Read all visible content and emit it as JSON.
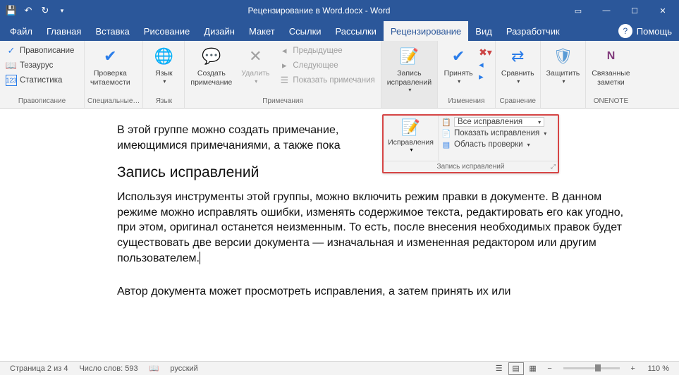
{
  "titlebar": {
    "title": "Рецензирование в Word.docx - Word"
  },
  "menu": {
    "file": "Файл",
    "home": "Главная",
    "insert": "Вставка",
    "draw": "Рисование",
    "design": "Дизайн",
    "layout": "Макет",
    "references": "Ссылки",
    "mailings": "Рассылки",
    "review": "Рецензирование",
    "view": "Вид",
    "developer": "Разработчик",
    "help": "Помощь"
  },
  "ribbon": {
    "proofing": {
      "spelling": "Правописание",
      "thesaurus": "Тезаурус",
      "statistics": "Статистика",
      "label": "Правописание"
    },
    "accessibility": {
      "check": "Проверка\nчитаемости",
      "label": "Специальные…"
    },
    "language": {
      "btn": "Язык",
      "label": "Язык"
    },
    "comments": {
      "new": "Создать\nпримечание",
      "delete": "Удалить",
      "prev": "Предыдущее",
      "next": "Следующее",
      "show": "Показать примечания",
      "label": "Примечания"
    },
    "tracking": {
      "track": "Запись\nисправлений",
      "label": ""
    },
    "changes": {
      "accept": "Принять",
      "label": "Изменения"
    },
    "compare": {
      "btn": "Сравнить",
      "label": "Сравнение"
    },
    "protect": {
      "btn": "Защитить",
      "label": ""
    },
    "onenote": {
      "btn": "Связанные\nзаметки",
      "label": "ONENOTE"
    }
  },
  "callout": {
    "left": "Исправления",
    "all": "Все исправления",
    "show": "Показать исправления",
    "area": "Область проверки",
    "footer": "Запись исправлений"
  },
  "document": {
    "p1": "В этой группе можно создать примечание,",
    "p2": "имеющимися примечаниями, а также пока",
    "h1": "Запись исправлений",
    "p3": "Используя инструменты этой группы, можно включить режим правки в документе. В данном режиме можно исправлять ошибки, изменять содержимое текста, редактировать его как угодно, при этом, оригинал останется неизменным. То есть, после внесения необходимых правок будет существовать две версии документа — изначальная и измененная редактором или другим пользователем.",
    "p4": "Автор документа может просмотреть исправления, а затем принять их или"
  },
  "status": {
    "page": "Страница 2 из 4",
    "words": "Число слов: 593",
    "lang": "русский",
    "zoom": "110 %"
  }
}
